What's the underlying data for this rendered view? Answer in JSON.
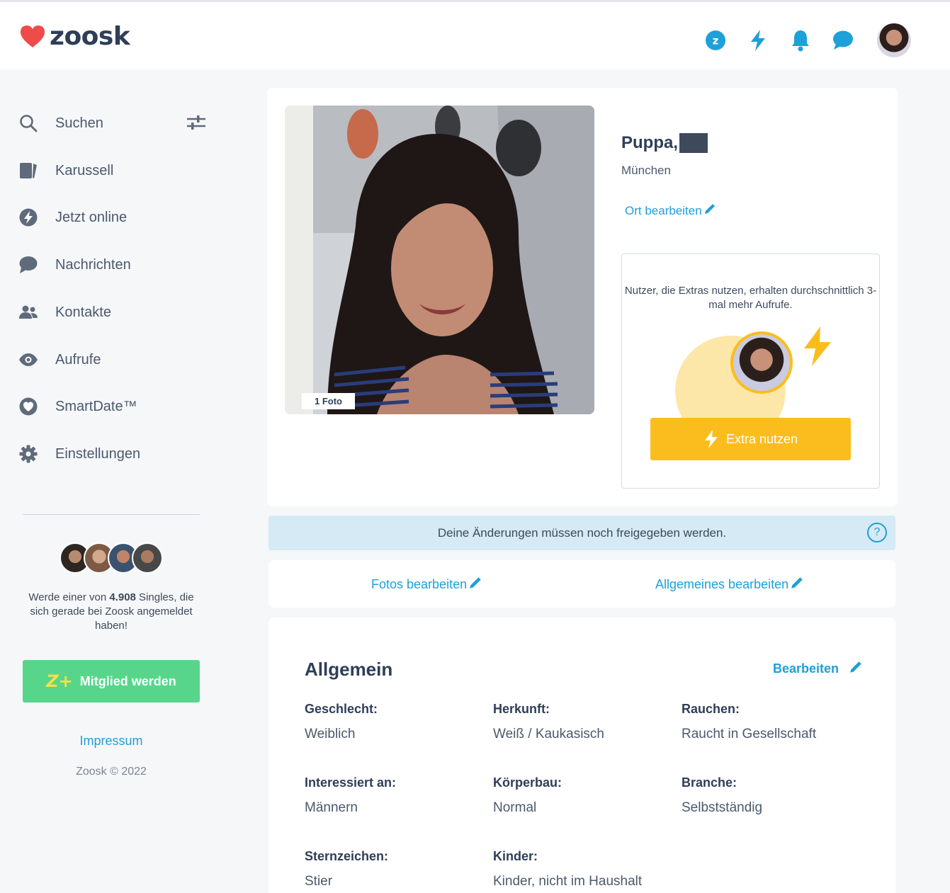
{
  "brand": {
    "name": "zoosk",
    "heart_color": "#ef4b4b"
  },
  "header": {
    "icons": [
      "zoosk-coin-icon",
      "bolt-icon",
      "bell-icon",
      "chat-icon"
    ],
    "accent": "#1ea0d8"
  },
  "sidebar": {
    "items": [
      {
        "label": "Suchen",
        "icon": "search-icon"
      },
      {
        "label": "Karussell",
        "icon": "carousel-icon"
      },
      {
        "label": "Jetzt online",
        "icon": "bolt-icon"
      },
      {
        "label": "Nachrichten",
        "icon": "chat-icon"
      },
      {
        "label": "Kontakte",
        "icon": "contacts-icon"
      },
      {
        "label": "Aufrufe",
        "icon": "eye-icon"
      },
      {
        "label": "SmartDate™",
        "icon": "smartdate-icon"
      },
      {
        "label": "Einstellungen",
        "icon": "gear-icon"
      }
    ],
    "promo_prefix": "Werde einer von ",
    "promo_count": "4.908",
    "promo_suffix": " Singles, die sich gerade bei Zoosk angemeldet haben!",
    "member_button": "Mitglied werden",
    "member_icon_text": "Z+",
    "impressum": "Impressum",
    "copyright": "Zoosk © 2022"
  },
  "profile": {
    "name": "Puppa,",
    "city": "München",
    "edit_location": "Ort bearbeiten",
    "photo_count": "1 Foto",
    "extras_text": "Nutzer, die Extras nutzen, erhalten durchschnittlich 3-mal mehr Aufrufe.",
    "extras_button": "Extra nutzen",
    "extras_color": "#fbbd1e"
  },
  "notice": {
    "text": "Deine Änderungen müssen noch freigegeben werden.",
    "help": "?"
  },
  "edit_bar": {
    "photos": "Fotos bearbeiten",
    "general": "Allgemeines bearbeiten"
  },
  "general": {
    "title": "Allgemein",
    "edit": "Bearbeiten",
    "fields": [
      {
        "label": "Geschlecht:",
        "value": "Weiblich"
      },
      {
        "label": "Herkunft:",
        "value": "Weiß / Kaukasisch"
      },
      {
        "label": "Rauchen:",
        "value": "Raucht in Gesellschaft"
      },
      {
        "label": "Interessiert an:",
        "value": "Männern"
      },
      {
        "label": "Körperbau:",
        "value": "Normal"
      },
      {
        "label": "Branche:",
        "value": "Selbstständig"
      },
      {
        "label": "Sternzeichen:",
        "value": "Stier"
      },
      {
        "label": "Kinder:",
        "value": "Kinder, nicht im Haushalt"
      }
    ]
  }
}
